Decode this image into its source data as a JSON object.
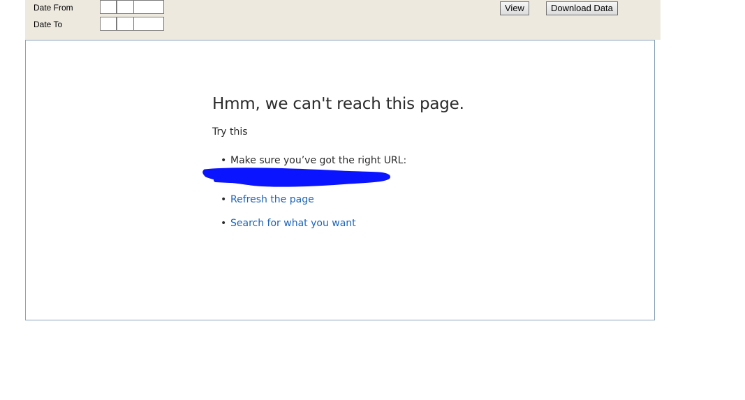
{
  "toolbar": {
    "date_from_label": "Date From",
    "date_to_label": "Date To",
    "view_label": "View",
    "download_label": "Download Data"
  },
  "error_page": {
    "title": "Hmm, we can't reach this page.",
    "subtitle": "Try this",
    "items": [
      "Make sure you’ve got the right URL:",
      "Refresh the page",
      "Search for what you want"
    ]
  },
  "colors": {
    "toolbar_bg": "#ede9df",
    "link": "#1b63b8",
    "redaction": "#0a14ff",
    "frame_border": "#8aa3bb"
  }
}
